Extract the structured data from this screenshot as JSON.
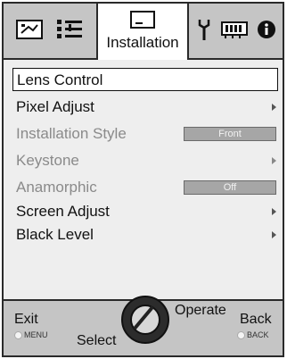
{
  "tabs": {
    "active_label": "Installation",
    "icons": [
      "picture-adjust-icon",
      "input-settings-icon",
      "installation-icon",
      "function-wrench-icon",
      "memory-icon",
      "information-icon"
    ]
  },
  "menu": {
    "items": [
      {
        "label": "Lens Control",
        "state": "selected",
        "submenu": true
      },
      {
        "label": "Pixel Adjust",
        "state": "enabled",
        "submenu": true
      },
      {
        "label": "Installation Style",
        "state": "disabled",
        "value": "Front"
      },
      {
        "label": "Keystone",
        "state": "disabled",
        "submenu": true
      },
      {
        "label": "Anamorphic",
        "state": "disabled",
        "value": "Off"
      },
      {
        "label": "Screen Adjust",
        "state": "enabled",
        "submenu": true
      },
      {
        "label": "Black Level",
        "state": "enabled",
        "submenu": true
      }
    ]
  },
  "footer": {
    "exit_label": "Exit",
    "exit_key": "MENU",
    "select_label": "Select",
    "operate_label": "Operate",
    "back_label": "Back",
    "back_key": "BACK"
  },
  "colors": {
    "bar_bg": "#c5c5c5",
    "panel_bg": "#eeeeee",
    "disabled_text": "#8a8a8a",
    "value_box": "#a6a6a6"
  }
}
